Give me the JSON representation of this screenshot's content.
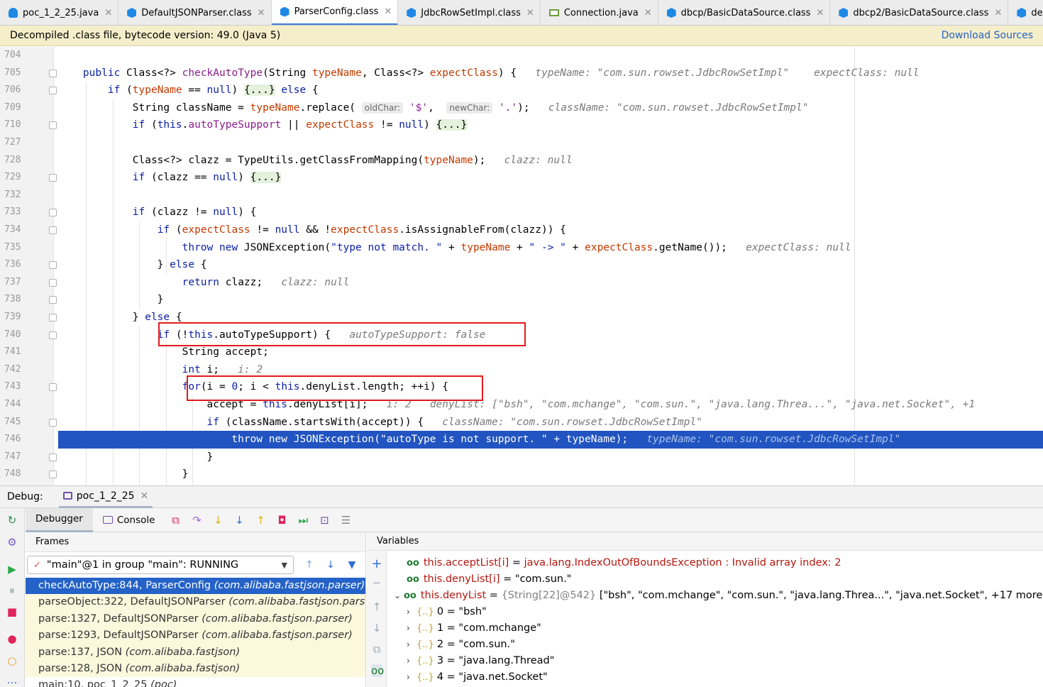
{
  "tabs": [
    {
      "label": "poc_1_2_25.java",
      "icon": "java-file-icon",
      "active": false
    },
    {
      "label": "DefaultJSONParser.class",
      "icon": "class-file-icon",
      "active": false
    },
    {
      "label": "ParserConfig.class",
      "icon": "class-file-icon",
      "active": true
    },
    {
      "label": "JdbcRowSetImpl.class",
      "icon": "class-file-icon",
      "active": false
    },
    {
      "label": "Connection.java",
      "icon": "interface-file-icon",
      "active": false
    },
    {
      "label": "dbcp/BasicDataSource.class",
      "icon": "class-file-icon",
      "active": false
    },
    {
      "label": "dbcp2/BasicDataSource.class",
      "icon": "class-file-icon",
      "active": false
    },
    {
      "label": "demoClass.java",
      "icon": "class-file-icon",
      "active": false
    }
  ],
  "infobar": {
    "message": "Decompiled .class file, bytecode version: 49.0 (Java 5)",
    "action": "Download Sources"
  },
  "editor": {
    "line_numbers": [
      "704",
      "705",
      "706",
      "709",
      "710",
      "727",
      "728",
      "729",
      "732",
      "733",
      "734",
      "735",
      "736",
      "737",
      "738",
      "739",
      "740",
      "741",
      "742",
      "743",
      "744",
      "745",
      "746",
      "747",
      "748"
    ],
    "hints": {
      "l705_a": "typeName: \"com.sun.rowset.JdbcRowSetImpl\"",
      "l705_b": "expectClass: null",
      "l709_pill1": "oldChar:",
      "l709_pill2": "newChar:",
      "l709": "className: \"com.sun.rowset.JdbcRowSetImpl\"",
      "l728": "clazz: null",
      "l735": "expectClass: null",
      "l737": "clazz: null",
      "l740": "autoTypeSupport: false",
      "l742": "i: 2",
      "l744_a": "i: 2",
      "l744_b": "denyList: [\"bsh\", \"com.mchange\", \"com.sun.\", \"java.lang.Threa...\", \"java.net.Socket\", +1",
      "l745": "className: \"com.sun.rowset.JdbcRowSetImpl\"",
      "l746": "typeName: \"com.sun.rowset.JdbcRowSetImpl\""
    }
  },
  "debug": {
    "label": "Debug:",
    "session": "poc_1_2_25",
    "tabs": {
      "debugger": "Debugger",
      "console": "Console"
    },
    "frames_header": "Frames",
    "variables_header": "Variables",
    "thread": "\"main\"@1 in group \"main\": RUNNING",
    "frames": [
      {
        "method": "checkAutoType:844, ParserConfig ",
        "pkg": "(com.alibaba.fastjson.parser)",
        "selected": true
      },
      {
        "method": "parseObject:322, DefaultJSONParser ",
        "pkg": "(com.alibaba.fastjson.parser)",
        "selected": false
      },
      {
        "method": "parse:1327, DefaultJSONParser ",
        "pkg": "(com.alibaba.fastjson.parser)",
        "selected": false
      },
      {
        "method": "parse:1293, DefaultJSONParser ",
        "pkg": "(com.alibaba.fastjson.parser)",
        "selected": false
      },
      {
        "method": "parse:137, JSON ",
        "pkg": "(com.alibaba.fastjson)",
        "selected": false
      },
      {
        "method": "parse:128, JSON ",
        "pkg": "(com.alibaba.fastjson)",
        "selected": false
      },
      {
        "method": "main:10, poc_1_2_25 ",
        "pkg": "(poc)",
        "selected": false
      }
    ],
    "variables": {
      "acceptList": {
        "name": "this.acceptList[i]",
        "eq": " = ",
        "value": "java.lang.IndexOutOfBoundsException : Invalid array index: 2"
      },
      "denyListI": {
        "name": "this.denyList[i]",
        "eq": " = ",
        "value": "\"com.sun.\""
      },
      "denyList": {
        "name": "this.denyList",
        "eq": " = ",
        "type": "{String[22]@542} ",
        "value": "[\"bsh\", \"com.mchange\", \"com.sun.\", \"java.lang.Threa...\", \"java.net.Socket\", +17 more]"
      },
      "items": [
        {
          "idx": "0",
          "value": "\"bsh\""
        },
        {
          "idx": "1",
          "value": "\"com.mchange\""
        },
        {
          "idx": "2",
          "value": "\"com.sun.\""
        },
        {
          "idx": "3",
          "value": "\"java.lang.Thread\""
        },
        {
          "idx": "4",
          "value": "\"java.net.Socket\""
        }
      ]
    }
  },
  "colors": {
    "accent": "#2154c0",
    "highlight_box": "#e01b1b",
    "infobar": "#f5eeca"
  }
}
